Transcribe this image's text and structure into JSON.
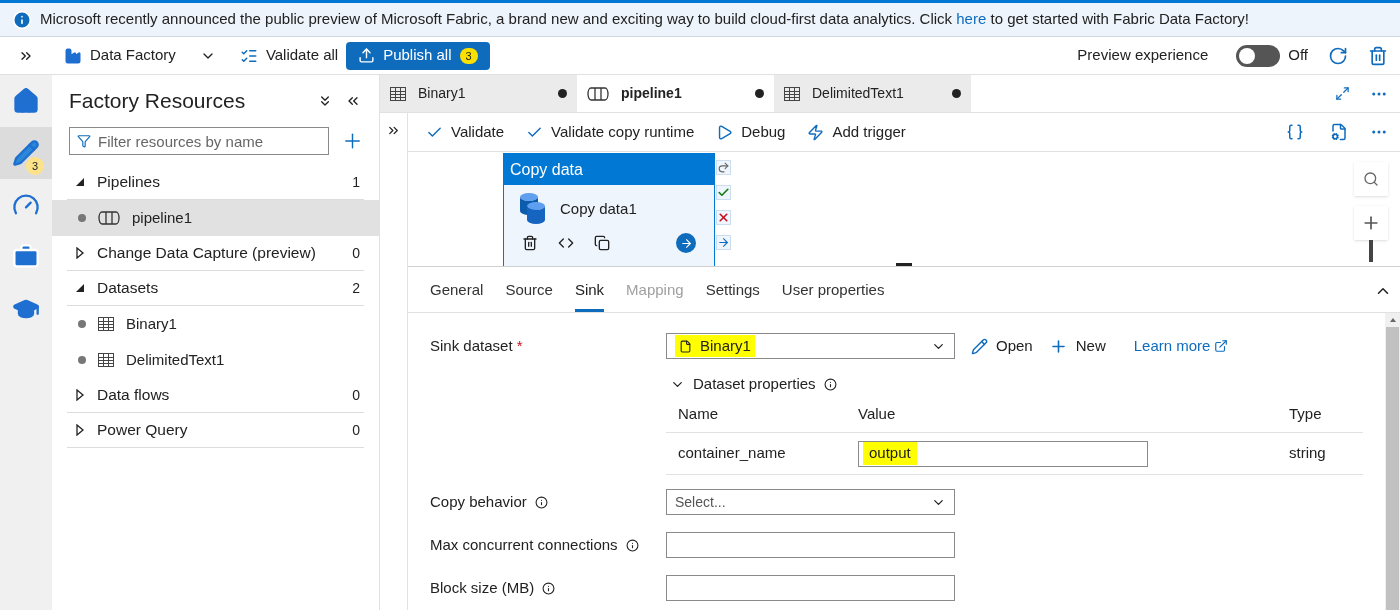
{
  "banner": {
    "text": "Microsoft recently announced the public preview of Microsoft Fabric, a brand new and exciting way to build cloud-first data analytics. Click",
    "link": "here",
    "text_after": "to get started with Fabric Data Factory!"
  },
  "toolbar": {
    "factory": "Data Factory",
    "validate_all": "Validate all",
    "publish": {
      "label": "Publish all",
      "badge": "3"
    },
    "preview": {
      "label": "Preview experience",
      "on": false,
      "state_label": "Off"
    }
  },
  "rail": [
    {
      "kind": "home",
      "selected": false
    },
    {
      "kind": "author",
      "selected": true,
      "badge": "3"
    },
    {
      "kind": "monitor",
      "selected": false
    },
    {
      "kind": "manage",
      "selected": false
    },
    {
      "kind": "learn",
      "selected": false
    }
  ],
  "resources": {
    "title": "Factory Resources",
    "filter_placeholder": "Filter resources by name",
    "groups": [
      {
        "label": "Pipelines",
        "count": "1",
        "expanded": true,
        "children": [
          {
            "label": "pipeline1",
            "kind": "pipeline",
            "selected": true
          }
        ]
      },
      {
        "label": "Change Data Capture (preview)",
        "count": "0",
        "expanded": false
      },
      {
        "label": "Datasets",
        "count": "2",
        "expanded": true,
        "children": [
          {
            "label": "Binary1",
            "kind": "dataset",
            "selected": false
          },
          {
            "label": "DelimitedText1",
            "kind": "dataset",
            "selected": false
          }
        ]
      },
      {
        "label": "Data flows",
        "count": "0",
        "expanded": false
      },
      {
        "label": "Power Query",
        "count": "0",
        "expanded": false
      }
    ]
  },
  "tabs": [
    {
      "label": "Binary1",
      "kind": "dataset",
      "selected": false,
      "unsaved": true
    },
    {
      "label": "pipeline1",
      "kind": "pipeline",
      "selected": true,
      "unsaved": true
    },
    {
      "label": "DelimitedText1",
      "kind": "dataset",
      "selected": false,
      "unsaved": true
    }
  ],
  "pipeline_actions": [
    {
      "kind": "check",
      "label": "Validate"
    },
    {
      "kind": "check",
      "label": "Validate copy runtime"
    },
    {
      "kind": "debug",
      "label": "Debug"
    },
    {
      "kind": "trigger",
      "label": "Add trigger"
    }
  ],
  "activity": {
    "header": "Copy data",
    "name": "Copy data1"
  },
  "property_tabs": [
    {
      "label": "General",
      "selected": false,
      "disabled": false
    },
    {
      "label": "Source",
      "selected": false,
      "disabled": false
    },
    {
      "label": "Sink",
      "selected": true,
      "disabled": false
    },
    {
      "label": "Mapping",
      "selected": false,
      "disabled": true
    },
    {
      "label": "Settings",
      "selected": false,
      "disabled": false
    },
    {
      "label": "User properties",
      "selected": false,
      "disabled": false
    }
  ],
  "sink": {
    "label": "Sink dataset",
    "required": "*",
    "dataset": "Binary1",
    "highlighted": true,
    "open": "Open",
    "new": "New",
    "learn_more": "Learn more"
  },
  "dataset_properties": {
    "title": "Dataset properties",
    "expanded": true,
    "columns": [
      "Name",
      "Value",
      "Type"
    ],
    "rows": [
      {
        "name": "container_name",
        "value": "output",
        "type": "string",
        "highlighted": true
      }
    ]
  },
  "fields": [
    {
      "label": "Copy behavior",
      "kind": "select",
      "placeholder": "Select..."
    },
    {
      "label": "Max concurrent connections",
      "kind": "input"
    },
    {
      "label": "Block size (MB)",
      "kind": "input"
    }
  ]
}
